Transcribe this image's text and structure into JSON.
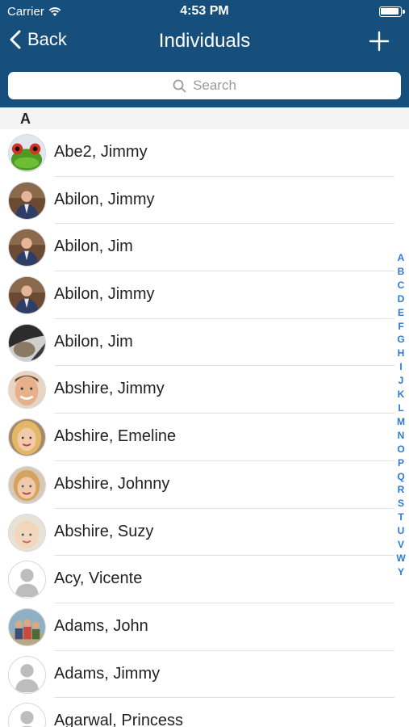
{
  "status_bar": {
    "carrier": "Carrier",
    "time": "4:53 PM"
  },
  "nav": {
    "back_label": "Back",
    "title": "Individuals"
  },
  "search": {
    "placeholder": "Search"
  },
  "section": {
    "letter": "A"
  },
  "contacts": [
    {
      "name": "Abe2, Jimmy",
      "avatar": "frog"
    },
    {
      "name": "Abilon, Jimmy",
      "avatar": "man-suit"
    },
    {
      "name": "Abilon, Jim",
      "avatar": "man-suit"
    },
    {
      "name": "Abilon, Jimmy",
      "avatar": "man-suit"
    },
    {
      "name": "Abilon, Jim",
      "avatar": "car-interior"
    },
    {
      "name": "Abshire, Jimmy",
      "avatar": "man-face"
    },
    {
      "name": "Abshire, Emeline",
      "avatar": "woman-blonde"
    },
    {
      "name": "Abshire, Johnny",
      "avatar": "child"
    },
    {
      "name": "Abshire, Suzy",
      "avatar": "toddler"
    },
    {
      "name": "Acy, Vicente",
      "avatar": "placeholder"
    },
    {
      "name": "Adams, John",
      "avatar": "group-photo"
    },
    {
      "name": "Adams, Jimmy",
      "avatar": "placeholder"
    },
    {
      "name": "Agarwal, Princess",
      "avatar": "placeholder"
    }
  ],
  "index_letters": [
    "A",
    "B",
    "C",
    "D",
    "E",
    "F",
    "G",
    "H",
    "I",
    "J",
    "K",
    "L",
    "M",
    "N",
    "O",
    "P",
    "Q",
    "R",
    "S",
    "T",
    "U",
    "V",
    "W",
    "Y"
  ],
  "colors": {
    "nav_bar": "#164e7c",
    "index_link": "#2c7ad6"
  }
}
